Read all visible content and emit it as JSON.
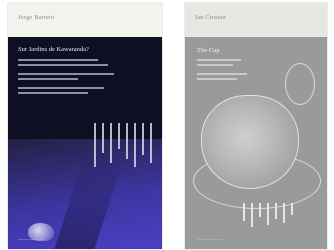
{
  "books": [
    {
      "author": "Jorge Barreto",
      "title": "Sur Jardins de Kawaranda?",
      "footer": "—————"
    },
    {
      "author": "Ian Crosant",
      "title": "The Cup",
      "footer": "—————"
    }
  ],
  "colors": {
    "book1_background": "#0f0f24",
    "book1_photo_tint": "#4a40c4",
    "book2_background": "#9a9a9c",
    "band": "#f2f2ee"
  }
}
